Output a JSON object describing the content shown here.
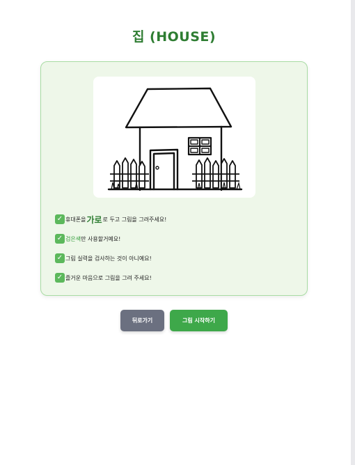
{
  "page": {
    "title": "집 (HOUSE)"
  },
  "illustration": {
    "subject": "house-drawing"
  },
  "instructions": [
    {
      "before": "휴대폰을 ",
      "highlight": "가로",
      "after": "로 두고 그림을 그려주세요!"
    },
    {
      "before": "",
      "highlight": "검은색",
      "after": "만 사용할거예요!"
    },
    {
      "before": "그림 실력을 검사하는 것이 아니예요!",
      "highlight": "",
      "after": ""
    },
    {
      "before": "즐거운 마음으로 그림을 그려 주세요!",
      "highlight": "",
      "after": ""
    }
  ],
  "buttons": {
    "back_label": "뒤로가기",
    "start_label": "그림 시작하기"
  },
  "colors": {
    "title": "#2e7d32",
    "card_bg": "#eef7e9",
    "card_border": "#a8dca3",
    "check": "#5cb85c",
    "back_button": "#6b7080",
    "start_button": "#3ea84a"
  },
  "icons": {
    "check": "check-mark-icon"
  }
}
